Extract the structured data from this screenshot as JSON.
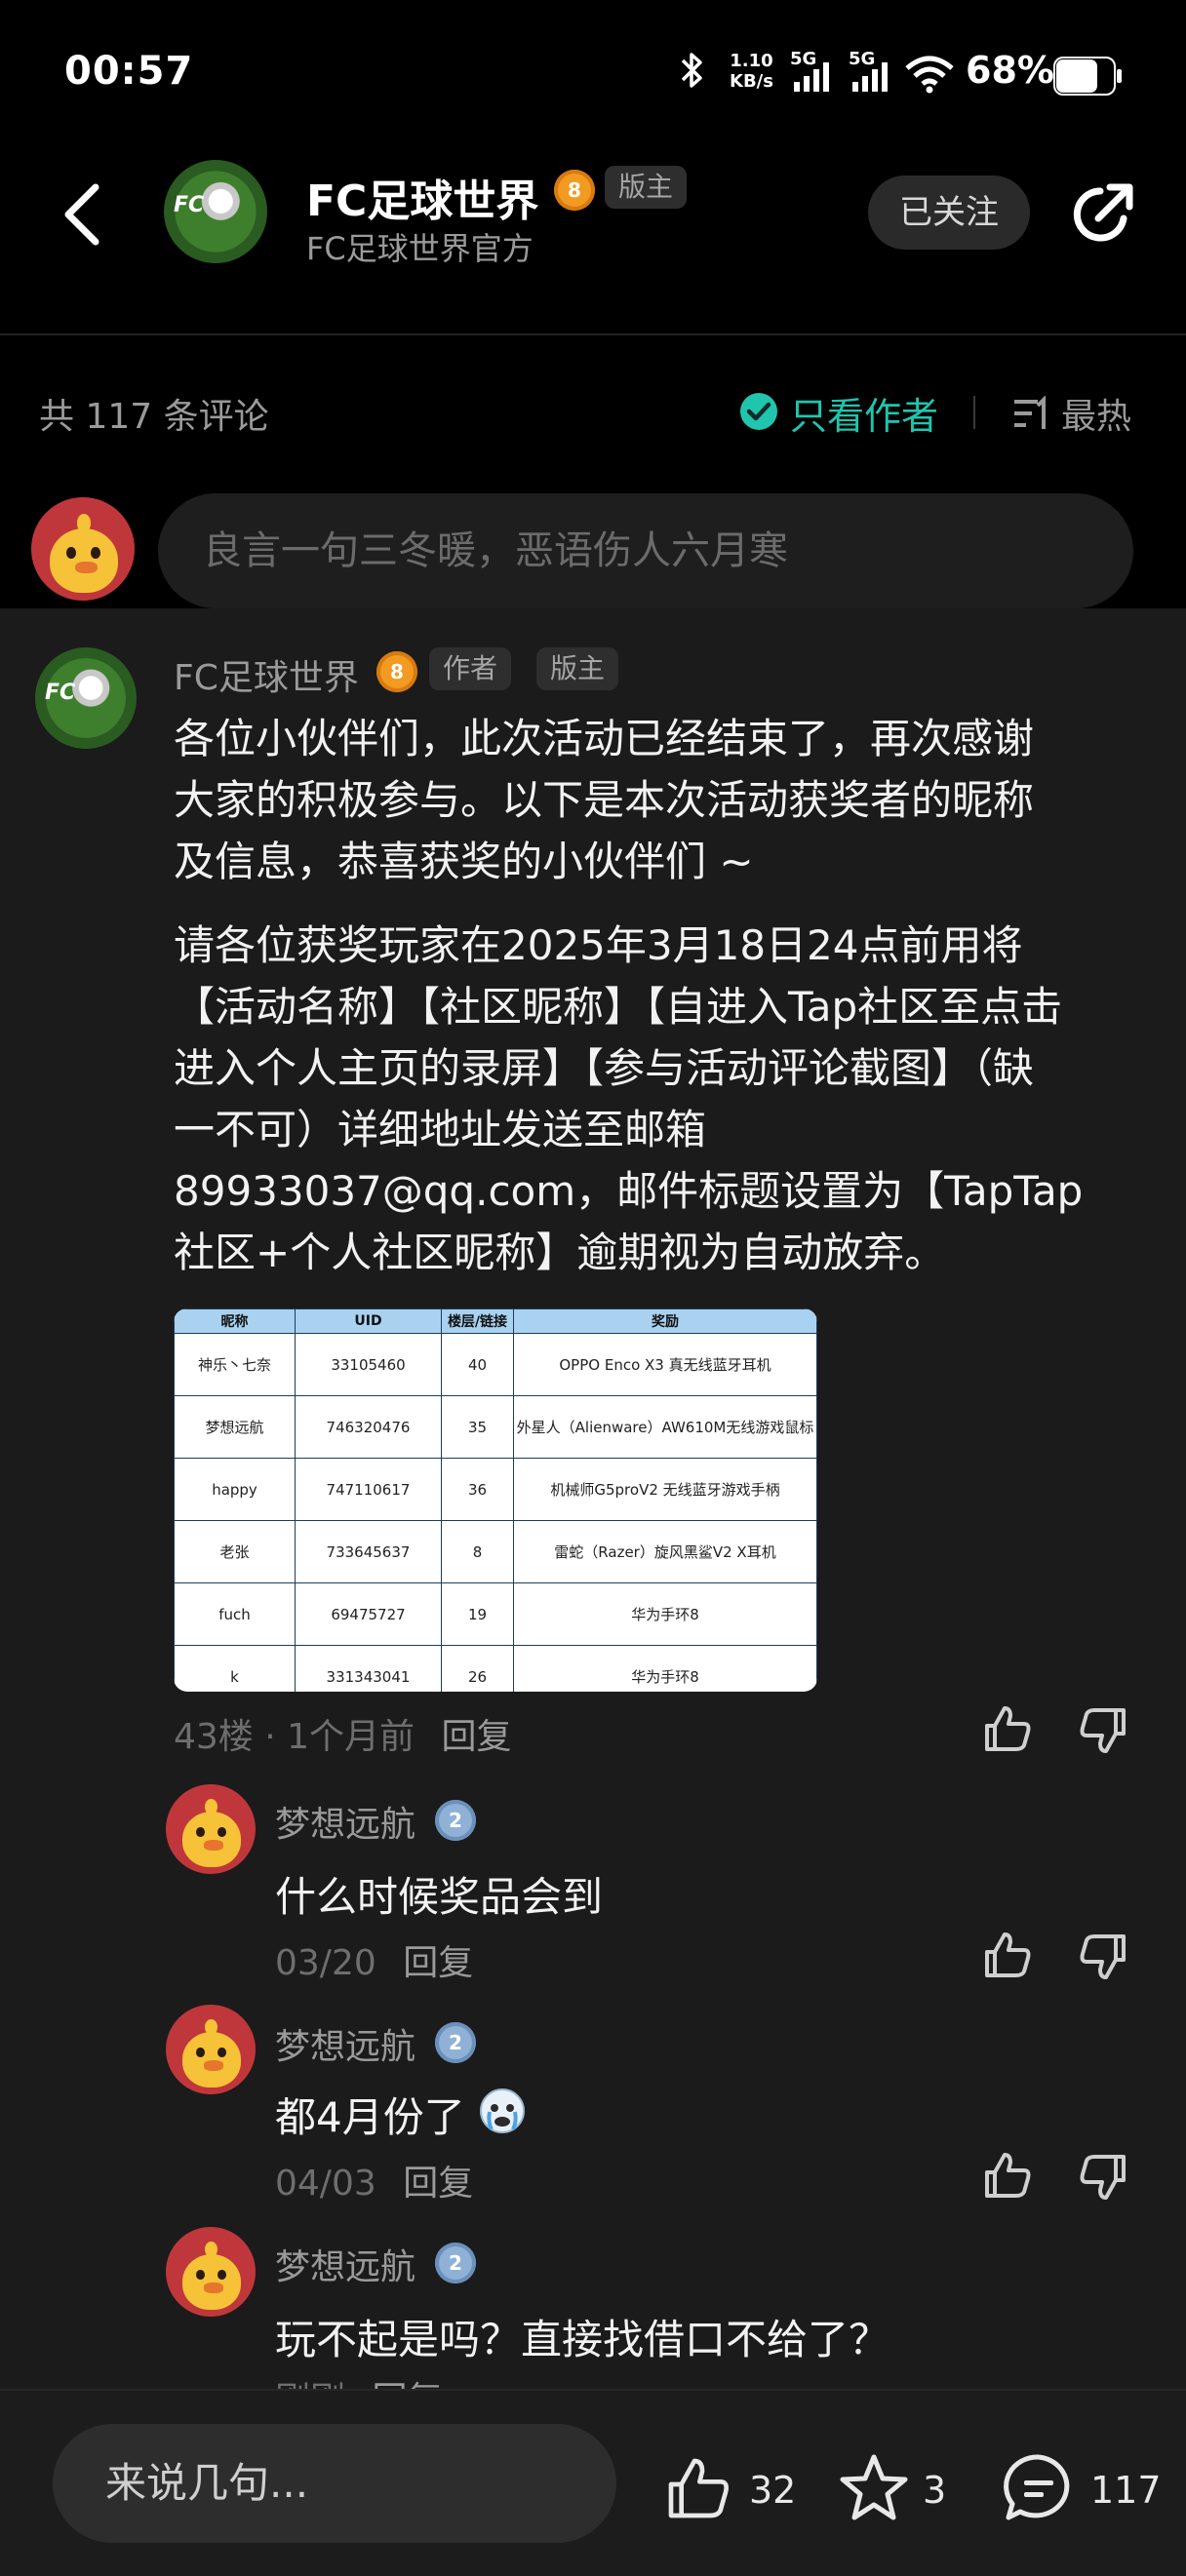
{
  "status_bar": {
    "time": "00:57",
    "net_speed_value": "1.10",
    "net_speed_unit": "KB/s",
    "sim1": "5G",
    "sim2": "5G",
    "battery": "68%"
  },
  "header": {
    "title": "FC足球世界",
    "level": "8",
    "role_tag": "版主",
    "subtitle": "FC足球世界官方",
    "follow_label": "已关注",
    "avatar_text": "FC"
  },
  "sort_bar": {
    "comment_count": "共 117 条评论",
    "author_only": "只看作者",
    "sort_label": "最热"
  },
  "compose": {
    "placeholder": "良言一句三冬暖，恶语伤人六月寒"
  },
  "post": {
    "author": "FC足球世界",
    "level": "8",
    "author_tag": "作者",
    "moderator_tag": "版主",
    "paragraphs": [
      "各位小伙伴们，此次活动已经结束了，再次感谢",
      "大家的积极参与。以下是本次活动获奖者的昵称",
      "及信息，恭喜获奖的小伙伴们 ~",
      "请各位获奖玩家在2025年3月18日24点前用将",
      "【活动名称】【社区昵称】【自进入Tap社区至点击",
      "进入个人主页的录屏】【参与活动评论截图】（缺",
      "一不可）详细地址发送至邮箱",
      "89933037@qq.com，邮件标题设置为【TapTap",
      "社区+个人社区昵称】逾期视为自动放弃。"
    ],
    "table": {
      "headers": [
        "昵称",
        "UID",
        "楼层/链接",
        "奖励"
      ],
      "rows": [
        [
          "神乐丶七奈",
          "33105460",
          "40",
          "OPPO Enco X3 真无线蓝牙耳机"
        ],
        [
          "梦想远航",
          "746320476",
          "35",
          "外星人（Alienware）AW610M无线游戏鼠标"
        ],
        [
          "happy",
          "747110617",
          "36",
          "机械师G5proV2 无线蓝牙游戏手柄"
        ],
        [
          "老张",
          "733645637",
          "8",
          "雷蛇（Razer）旋风黑鲨V2 X耳机"
        ],
        [
          "fuch",
          "69475727",
          "19",
          "华为手环8"
        ],
        [
          "k",
          "331343041",
          "26",
          "华为手环8"
        ]
      ]
    },
    "meta": "43楼 · 1个月前",
    "reply_label": "回复"
  },
  "replies": [
    {
      "name": "梦想远航",
      "level": "2",
      "text": "什么时候奖品会到",
      "date": "03/20",
      "reply_label": "回复"
    },
    {
      "name": "梦想远航",
      "level": "2",
      "text": "都4月份了",
      "date": "04/03",
      "reply_label": "回复"
    },
    {
      "name": "梦想远航",
      "level": "2",
      "text": "玩不起是吗？直接找借口不给了？",
      "date": "刚刚",
      "reply_label": "回复"
    }
  ],
  "bottom_bar": {
    "placeholder": "来说几句...",
    "like_count": "32",
    "favorite_count": "3",
    "comment_count": "117"
  },
  "colors": {
    "accent": "#20c5ae",
    "badge_orange": "#f39a21",
    "badge_blue": "#8fb1d6",
    "background": "#1b1b1b"
  },
  "icons": [
    "back-icon",
    "share-icon",
    "check-circle-icon",
    "sort-icon",
    "thumb-up-icon",
    "thumb-down-icon",
    "star-icon",
    "comment-icon",
    "bluetooth-icon",
    "wifi-icon",
    "battery-icon"
  ]
}
